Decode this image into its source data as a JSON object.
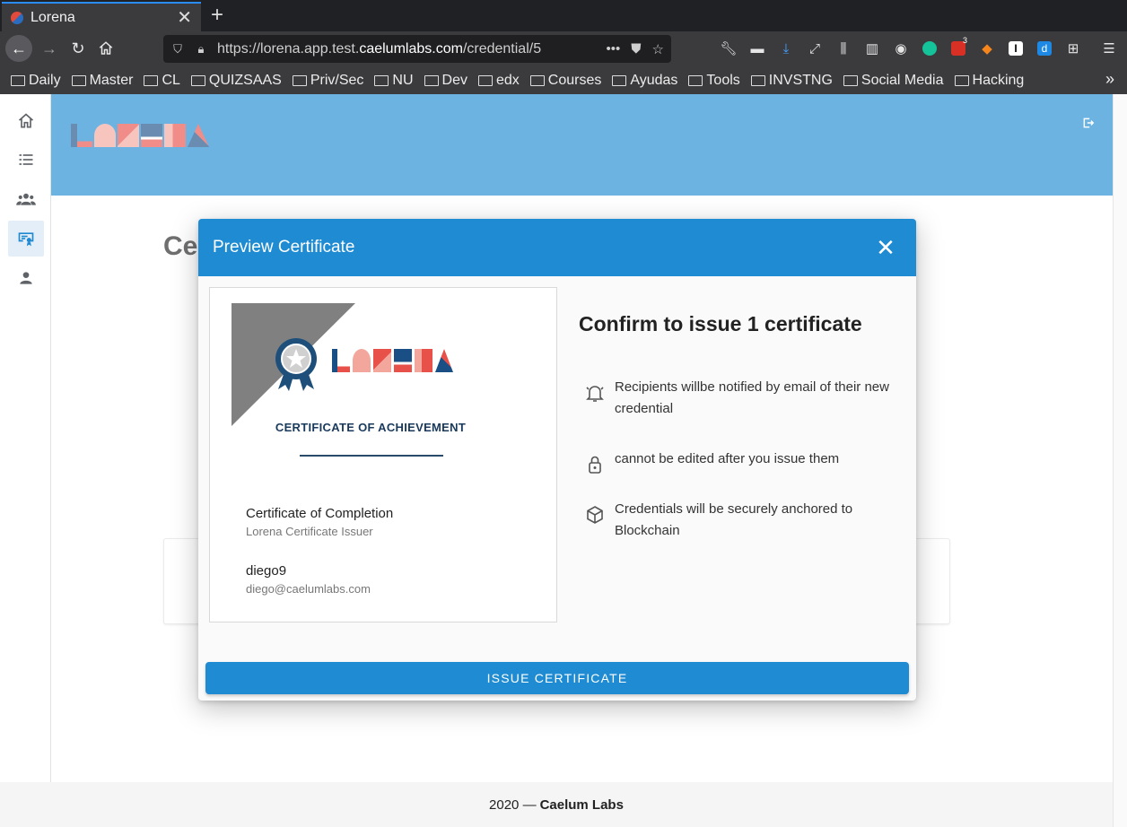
{
  "browser": {
    "tab_title": "Lorena",
    "tab_close": "✕",
    "new_tab": "+",
    "url_prefix": "https://lorena.app.test.",
    "url_domain": "caelumlabs.com",
    "url_path": "/credential/5",
    "notification_count": "3",
    "bookmarks": [
      "Daily",
      "Master",
      "CL",
      "QUIZSAAS",
      "Priv/Sec",
      "NU",
      "Dev",
      "edx",
      "Courses",
      "Ayudas",
      "Tools",
      "INVSTNG",
      "Social Media",
      "Hacking"
    ]
  },
  "app": {
    "logo_letters": [
      "L",
      "O",
      "R",
      "E",
      "N",
      "A"
    ],
    "background_title": "Ce",
    "footer_year": "2020 —",
    "footer_company": "Caelum Labs"
  },
  "modal": {
    "title": "Preview Certificate",
    "close_label": "✕",
    "certificate": {
      "heading": "CERTIFICATE OF ACHIEVEMENT",
      "name": "Certificate of Completion",
      "issuer": "Lorena Certificate Issuer",
      "recipient": "diego9",
      "recipient_email": "diego@caelumlabs.com"
    },
    "confirm_title": "Confirm to issue 1 certificate",
    "info": [
      {
        "icon": "bell-icon",
        "text": "Recipients willbe notified by email of their new credential"
      },
      {
        "icon": "lock-icon",
        "text": "cannot be edited after you issue them"
      },
      {
        "icon": "cube-icon",
        "text": "Credentials will be securely anchored to Blockchain"
      }
    ],
    "issue_button": "ISSUE CERTIFICATE"
  },
  "colors": {
    "primary": "#1e8bd2",
    "logo_red": "#e8504a",
    "logo_pink": "#f3a79c",
    "logo_navy": "#1a4f86",
    "badge_navy": "#1d4f7a"
  }
}
